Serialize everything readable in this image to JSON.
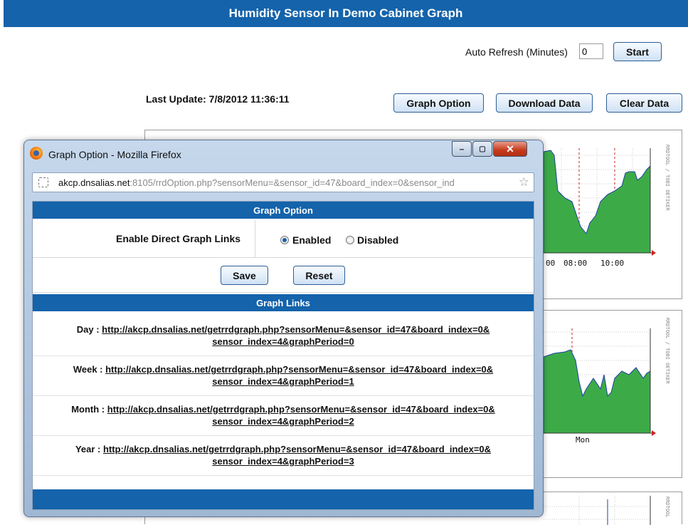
{
  "page": {
    "title": "Humidity Sensor In Demo Cabinet Graph",
    "auto_refresh_label": "Auto Refresh (Minutes)",
    "auto_refresh_value": "0",
    "start_button": "Start",
    "last_update": "Last Update: 7/8/2012 11:36:11",
    "graph_option_button": "Graph Option",
    "download_button": "Download Data",
    "clear_button": "Clear Data"
  },
  "graphs": [
    {
      "watermark": "RRDTOOL / TOBI OETIKER",
      "x_ticks": [
        "00",
        "08:00",
        "10:00"
      ],
      "tick_prefix": ":"
    },
    {
      "watermark": "RRDTOOL / TOBI OETIKER",
      "x_ticks": [
        "Mon"
      ]
    },
    {
      "watermark": "RRDTOOL"
    }
  ],
  "colors": {
    "header_blue": "#1463ab",
    "graph_fill": "#3cab47",
    "graph_line": "#1f3fa6",
    "grid_red": "#cc2222"
  },
  "popup": {
    "window_title": "Graph Option - Mozilla Firefox",
    "url_host": "akcp.dnsalias.net",
    "url_rest": ":8105/rrdOption.php?sensorMenu=&sensor_id=47&board_index=0&sensor_ind",
    "minimize": "–",
    "maximize": "▢",
    "close": "✕",
    "option_header": "Graph Option",
    "direct_links_label": "Enable Direct Graph Links",
    "enabled_label": "Enabled",
    "disabled_label": "Disabled",
    "enabled_selected": true,
    "save_button": "Save",
    "reset_button": "Reset",
    "links_header": "Graph Links",
    "links": [
      {
        "label": "Day : ",
        "url_line1": "http://akcp.dnsalias.net/getrrdgraph.php?sensorMenu=&sensor_id=47&board_index=0&",
        "url_line2": "sensor_index=4&graphPeriod=0"
      },
      {
        "label": "Week : ",
        "url_line1": "http://akcp.dnsalias.net/getrrdgraph.php?sensorMenu=&sensor_id=47&board_index=0&",
        "url_line2": "sensor_index=4&graphPeriod=1"
      },
      {
        "label": "Month : ",
        "url_line1": "http://akcp.dnsalias.net/getrrdgraph.php?sensorMenu=&sensor_id=47&board_index=0&",
        "url_line2": "sensor_index=4&graphPeriod=2"
      },
      {
        "label": "Year : ",
        "url_line1": "http://akcp.dnsalias.net/getrrdgraph.php?sensorMenu=&sensor_id=47&board_index=0&",
        "url_line2": "sensor_index=4&graphPeriod=3"
      }
    ]
  }
}
